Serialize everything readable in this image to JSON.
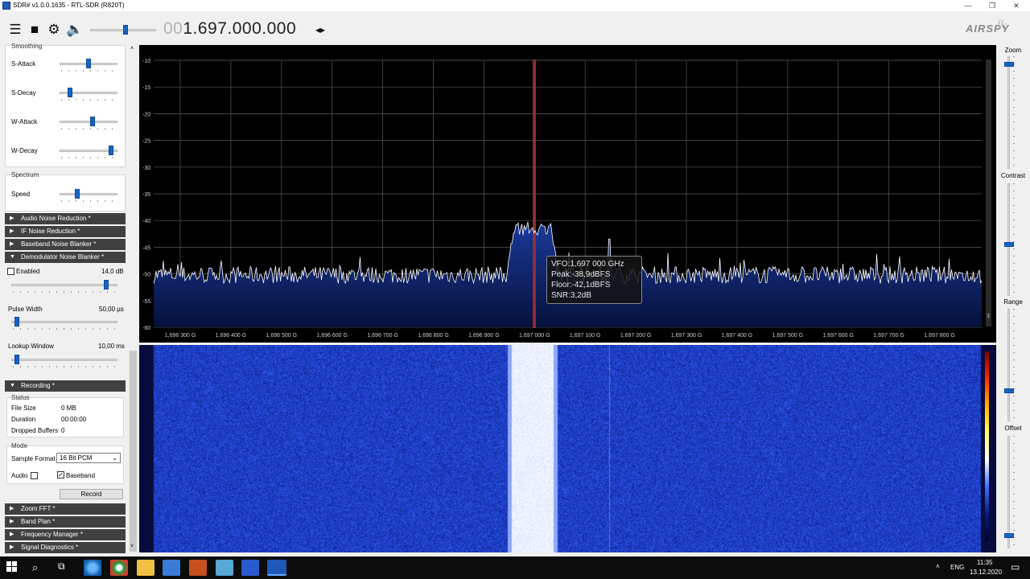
{
  "window": {
    "title": "SDR# v1.0.0.1635 - RTL-SDR (R820T)",
    "minimize": "—",
    "restore": "❐",
    "close": "✕"
  },
  "toolbar": {
    "frequency_dim": "00",
    "frequency": "1.697.000.000",
    "freq_arrows": "◂▸",
    "logo": "AIRSPY",
    "volume_level": 0.55
  },
  "left_panel": {
    "smoothing": {
      "title": "Smoothing",
      "s_attack": {
        "label": "S-Attack",
        "value": 0.52
      },
      "s_decay": {
        "label": "S-Decay",
        "value": 0.15
      },
      "w_attack": {
        "label": "W-Attack",
        "value": 0.6
      },
      "w_decay": {
        "label": "W-Decay",
        "value": 0.95
      }
    },
    "spectrum": {
      "title": "Spectrum",
      "speed": {
        "label": "Speed",
        "value": 0.3
      }
    },
    "sections": {
      "audio_nr": "Audio Noise Reduction *",
      "if_nr": "IF Noise Reduction *",
      "baseband_nb": "Baseband Noise Blanker *",
      "demod_nb": "Demodulator Noise Blanker *"
    },
    "demod_nb": {
      "enabled_label": "Enabled",
      "enabled_value": "14,0 dB",
      "enabled_level": 0.93,
      "pulse_width_label": "Pulse Width",
      "pulse_width_value": "50,00 µs",
      "pulse_width_level": 0.03,
      "lookup_window_label": "Lookup Window",
      "lookup_window_value": "10,00 ms",
      "lookup_window_level": 0.03
    },
    "recording": {
      "header": "Recording *",
      "status_label": "Status",
      "file_size_label": "File Size",
      "file_size_value": "0 MB",
      "duration_label": "Duration",
      "duration_value": "00:00:00",
      "dropped_label": "Dropped Buffers",
      "dropped_value": "0",
      "mode_label": "Mode",
      "sample_format_label": "Sample Format",
      "sample_format_value": "16 Bit PCM",
      "audio_label": "Audio",
      "baseband_label": "Baseband",
      "record_button": "Record"
    },
    "more_sections": {
      "zoom_fft": "Zoom FFT *",
      "band_plan": "Band Plan *",
      "frequency_manager": "Frequency Manager *",
      "signal_diagnostics": "Signal Diagnostics *"
    }
  },
  "spectrum": {
    "y_ticks": [
      "-10",
      "-15",
      "-20",
      "-25",
      "-30",
      "-35",
      "-40",
      "-45",
      "-50",
      "-55",
      "-60"
    ],
    "x_ticks": [
      "1,696 300 G",
      "1,696 400 G",
      "1,696 500 G",
      "1,696 600 G",
      "1,696 700 G",
      "1,696 800 G",
      "1,696 900 G",
      "1,697 000 G",
      "1,697 100 G",
      "1,697 200 G",
      "1,697 300 G",
      "1,697 400 G",
      "1,697 500 G",
      "1,697 600 G",
      "1,697 700 G",
      "1,697 800 G"
    ],
    "right_marker": "3",
    "tooltip": {
      "vfo": "VFO:1,697 000 GHz",
      "peak": "Peak:-38,9dBFS",
      "floor": "Floor:-42,1dBFS",
      "snr": "SNR:3,2dB"
    },
    "colors": {
      "trace": "#ffffff",
      "fill": "#0b1a5c",
      "vfo": "#a33030",
      "grid": "#5a5a5a"
    }
  },
  "right_panel": {
    "zoom_label": "Zoom",
    "contrast_label": "Contrast",
    "range_label": "Range",
    "offset_label": "Offset",
    "zoom_level": 0.95,
    "contrast_level": 0.45,
    "range_level": 0.25,
    "offset_level": 0.08
  },
  "taskbar": {
    "language": "ENG",
    "time": "11:35",
    "date": "13.12.2020"
  }
}
